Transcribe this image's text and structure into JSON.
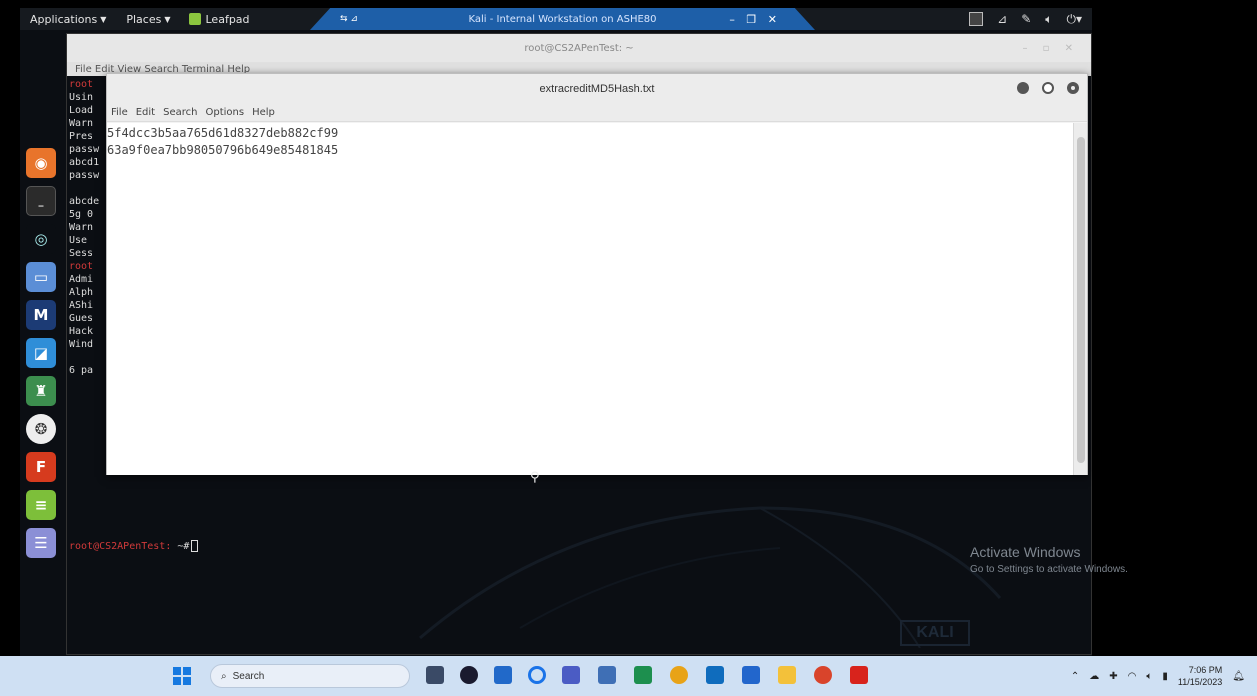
{
  "kali_panel": {
    "applications_label": "Applications",
    "places_label": "Places",
    "leafpad_task_label": "Leafpad",
    "vm_window_title": "Kali - Internal Workstation on ASHE80",
    "vm_left_icons": "⇆ ⊿",
    "vm_controls": "– ❐ ✕"
  },
  "terminal": {
    "title": "root@CS2APenTest: ~",
    "controls": "– ▫ ✕",
    "menu": "File  Edit  View  Search  Terminal  Help",
    "lines": [
      {
        "text": "root",
        "color": "red"
      },
      {
        "text": "Usin",
        "color": "plain"
      },
      {
        "text": "Load",
        "color": "plain"
      },
      {
        "text": "Warn",
        "color": "plain"
      },
      {
        "text": "Pres",
        "color": "plain"
      },
      {
        "text": "passw",
        "color": "plain"
      },
      {
        "text": "abcd1",
        "color": "plain"
      },
      {
        "text": "passw",
        "color": "plain"
      },
      {
        "text": "",
        "color": "blank"
      },
      {
        "text": "abcde",
        "color": "plain"
      },
      {
        "text": "5g 0",
        "color": "plain"
      },
      {
        "text": "Warn",
        "color": "plain"
      },
      {
        "text": "Use",
        "color": "plain"
      },
      {
        "text": "Sess",
        "color": "plain"
      },
      {
        "text": "root",
        "color": "red"
      },
      {
        "text": "Admi",
        "color": "plain"
      },
      {
        "text": "Alph",
        "color": "plain"
      },
      {
        "text": "AShi",
        "color": "plain"
      },
      {
        "text": "Gues",
        "color": "plain"
      },
      {
        "text": "Hack",
        "color": "plain"
      },
      {
        "text": "Wind",
        "color": "plain"
      },
      {
        "text": "",
        "color": "blank"
      },
      {
        "text": "6 pa",
        "color": "plain"
      }
    ],
    "prompt": "root@CS2APenTest:",
    "prompt_suffix": "~#"
  },
  "leafpad": {
    "title": "extracreditMD5Hash.txt",
    "menu": [
      "File",
      "Edit",
      "Search",
      "Options",
      "Help"
    ],
    "content_lines": [
      "5f4dcc3b5aa765d61d8327deb882cf99",
      "63a9f0ea7bb98050796b649e85481845"
    ]
  },
  "watermark": {
    "line1": "Activate Windows",
    "line2": "Go to Settings to activate Windows.",
    "kali_logo": "KALI"
  },
  "dock": {
    "icons": [
      "firefox-icon",
      "terminal-icon",
      "eye-icon",
      "files-icon",
      "metasploit-icon",
      "burp-icon",
      "armitage-icon",
      "beef-icon",
      "faraday-icon",
      "leafpad-icon",
      "notes-icon"
    ]
  },
  "taskbar": {
    "search_placeholder": "Search",
    "time": "7:06 PM",
    "date": "11/15/2023"
  }
}
